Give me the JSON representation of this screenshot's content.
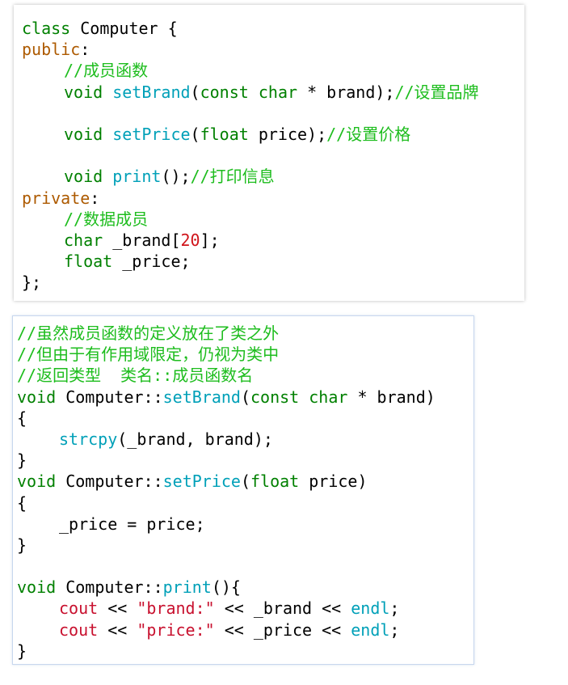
{
  "top": {
    "lines": [
      {
        "indent": 0,
        "tokens": [
          {
            "t": "class",
            "c": "kw"
          },
          {
            "t": " Computer {",
            "c": ""
          }
        ]
      },
      {
        "indent": 0,
        "tokens": [
          {
            "t": "public",
            "c": "ac"
          },
          {
            "t": ":",
            "c": ""
          }
        ]
      },
      {
        "indent": 1,
        "tokens": [
          {
            "t": "//成员函数",
            "c": "cm"
          }
        ]
      },
      {
        "indent": 1,
        "tokens": [
          {
            "t": "void",
            "c": "kw"
          },
          {
            "t": " ",
            "c": ""
          },
          {
            "t": "setBrand",
            "c": "fn"
          },
          {
            "t": "(",
            "c": ""
          },
          {
            "t": "const",
            "c": "kw"
          },
          {
            "t": " ",
            "c": ""
          },
          {
            "t": "char",
            "c": "kw"
          },
          {
            "t": " * brand);",
            "c": ""
          },
          {
            "t": "//设置品牌",
            "c": "cm"
          }
        ]
      },
      {
        "indent": 0,
        "tokens": []
      },
      {
        "indent": 1,
        "tokens": [
          {
            "t": "void",
            "c": "kw"
          },
          {
            "t": " ",
            "c": ""
          },
          {
            "t": "setPrice",
            "c": "fn"
          },
          {
            "t": "(",
            "c": ""
          },
          {
            "t": "float",
            "c": "kw"
          },
          {
            "t": " price);",
            "c": ""
          },
          {
            "t": "//设置价格",
            "c": "cm"
          }
        ]
      },
      {
        "indent": 0,
        "tokens": []
      },
      {
        "indent": 1,
        "tokens": [
          {
            "t": "void",
            "c": "kw"
          },
          {
            "t": " ",
            "c": ""
          },
          {
            "t": "print",
            "c": "fn"
          },
          {
            "t": "();",
            "c": ""
          },
          {
            "t": "//打印信息",
            "c": "cm"
          }
        ]
      },
      {
        "indent": 0,
        "tokens": [
          {
            "t": "private",
            "c": "ac"
          },
          {
            "t": ":",
            "c": ""
          }
        ]
      },
      {
        "indent": 1,
        "tokens": [
          {
            "t": "//数据成员",
            "c": "cm"
          }
        ]
      },
      {
        "indent": 1,
        "tokens": [
          {
            "t": "char",
            "c": "kw"
          },
          {
            "t": " _brand[",
            "c": ""
          },
          {
            "t": "20",
            "c": "num"
          },
          {
            "t": "];",
            "c": ""
          }
        ]
      },
      {
        "indent": 1,
        "tokens": [
          {
            "t": "float",
            "c": "kw"
          },
          {
            "t": " _price;",
            "c": ""
          }
        ]
      },
      {
        "indent": 0,
        "tokens": [
          {
            "t": "};",
            "c": ""
          }
        ]
      }
    ]
  },
  "bottom": {
    "lines": [
      {
        "indent": 0,
        "tokens": [
          {
            "t": "//虽然成员函数的定义放在了类之外",
            "c": "cm"
          }
        ]
      },
      {
        "indent": 0,
        "tokens": [
          {
            "t": "//但由于有作用域限定，仍视为类中",
            "c": "cm"
          }
        ]
      },
      {
        "indent": 0,
        "tokens": [
          {
            "t": "//返回类型  类名::成员函数名",
            "c": "cm"
          }
        ]
      },
      {
        "indent": 0,
        "tokens": [
          {
            "t": "void",
            "c": "kw"
          },
          {
            "t": " Computer::",
            "c": ""
          },
          {
            "t": "setBrand",
            "c": "fn"
          },
          {
            "t": "(",
            "c": ""
          },
          {
            "t": "const",
            "c": "kw"
          },
          {
            "t": " ",
            "c": ""
          },
          {
            "t": "char",
            "c": "kw"
          },
          {
            "t": " * brand)",
            "c": ""
          }
        ]
      },
      {
        "indent": 0,
        "tokens": [
          {
            "t": "{",
            "c": ""
          }
        ]
      },
      {
        "indent": 1,
        "tokens": [
          {
            "t": "strcpy",
            "c": "fn"
          },
          {
            "t": "(_brand, brand);",
            "c": ""
          }
        ]
      },
      {
        "indent": 0,
        "tokens": [
          {
            "t": "}",
            "c": ""
          }
        ]
      },
      {
        "indent": 0,
        "tokens": [
          {
            "t": "void",
            "c": "kw"
          },
          {
            "t": " Computer::",
            "c": ""
          },
          {
            "t": "setPrice",
            "c": "fn"
          },
          {
            "t": "(",
            "c": ""
          },
          {
            "t": "float",
            "c": "kw"
          },
          {
            "t": " price)",
            "c": ""
          }
        ]
      },
      {
        "indent": 0,
        "tokens": [
          {
            "t": "{",
            "c": ""
          }
        ]
      },
      {
        "indent": 1,
        "tokens": [
          {
            "t": "_price = price;",
            "c": ""
          }
        ]
      },
      {
        "indent": 0,
        "tokens": [
          {
            "t": "}",
            "c": ""
          }
        ]
      },
      {
        "indent": 0,
        "tokens": []
      },
      {
        "indent": 0,
        "tokens": [
          {
            "t": "void",
            "c": "kw"
          },
          {
            "t": " Computer::",
            "c": ""
          },
          {
            "t": "print",
            "c": "fn"
          },
          {
            "t": "(){",
            "c": ""
          }
        ]
      },
      {
        "indent": 1,
        "tokens": [
          {
            "t": "cout",
            "c": "rd"
          },
          {
            "t": " << ",
            "c": ""
          },
          {
            "t": "\"brand:\"",
            "c": "rd"
          },
          {
            "t": " << _brand << ",
            "c": ""
          },
          {
            "t": "endl",
            "c": "cy"
          },
          {
            "t": ";",
            "c": ""
          }
        ]
      },
      {
        "indent": 1,
        "tokens": [
          {
            "t": "cout",
            "c": "rd"
          },
          {
            "t": " << ",
            "c": ""
          },
          {
            "t": "\"price:\"",
            "c": "rd"
          },
          {
            "t": " << _price << ",
            "c": ""
          },
          {
            "t": "endl",
            "c": "cy"
          },
          {
            "t": ";",
            "c": ""
          }
        ]
      },
      {
        "indent": 0,
        "tokens": [
          {
            "t": "}",
            "c": ""
          }
        ]
      }
    ]
  },
  "colors": {
    "keyword": "#008000",
    "access": "#ad5a00",
    "function": "#00a0b8",
    "comment": "#1ebd1e",
    "number": "#d0141a",
    "string": "#c8102e",
    "text": "#000000"
  }
}
